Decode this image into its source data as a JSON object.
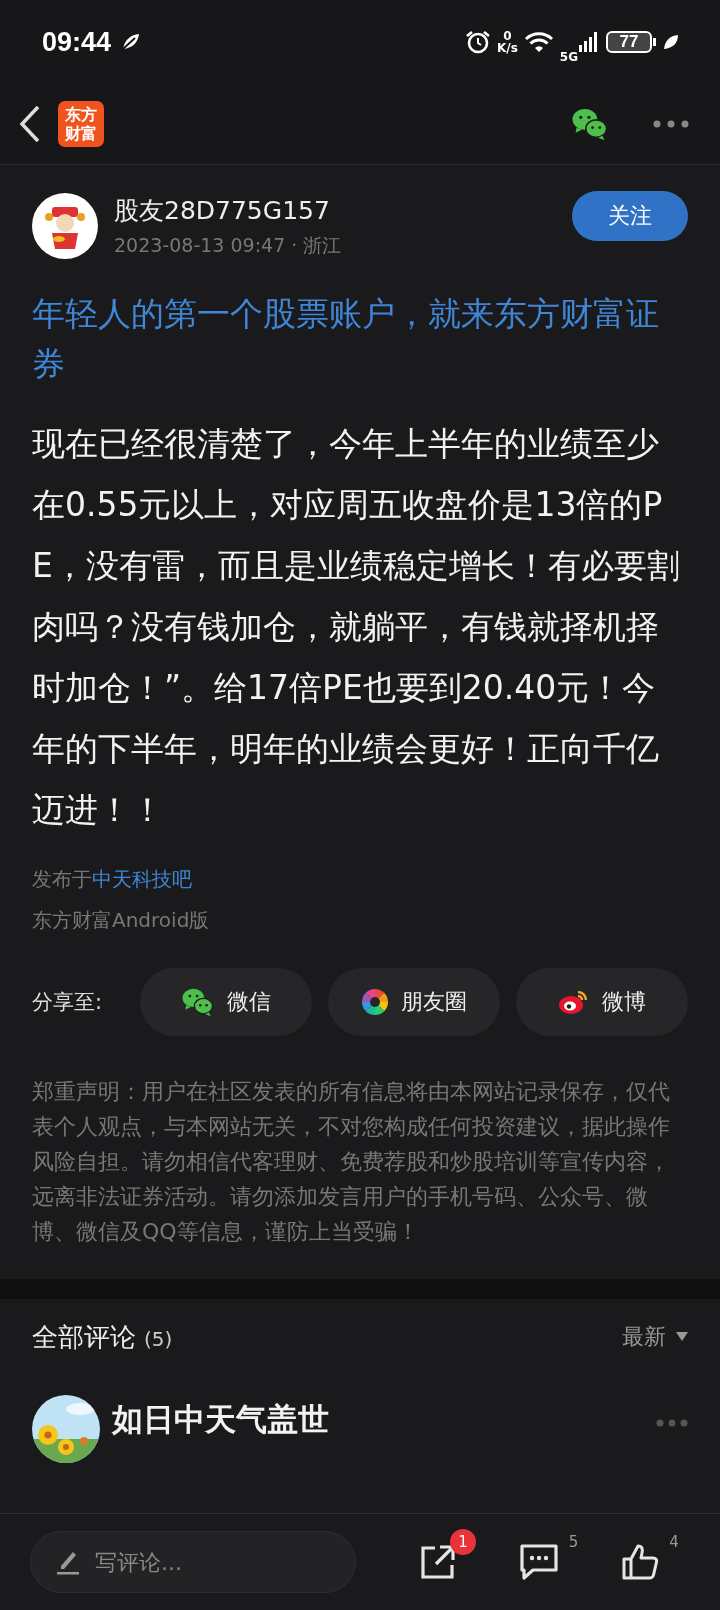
{
  "status_bar": {
    "time": "09:44",
    "net_speed_value": "0",
    "net_speed_unit": "K/s",
    "network": "5G",
    "battery": "77"
  },
  "header": {
    "logo": [
      "东方",
      "财富"
    ]
  },
  "post": {
    "author": "股友28D775G157",
    "meta": "2023-08-13 09:47 · 浙江",
    "follow_button": "关注",
    "title": "年轻人的第一个股票账户，就来东方财富证券",
    "body": "现在已经很清楚了，今年上半年的业绩至少在0.55元以上，对应周五收盘价是13倍的PE，没有雷，而且是业绩稳定增长！有必要割肉吗？没有钱加仓，就躺平，有钱就择机择时加仓！”。给17倍PE也要到20.40元！今年的下半年，明年的业绩会更好！正向千亿迈进！！",
    "published_in_label": "发布于",
    "forum": "中天科技吧",
    "source": "东方财富Android版"
  },
  "share": {
    "label": "分享至:",
    "buttons": [
      {
        "kind": "wechat",
        "label": "微信"
      },
      {
        "kind": "moments",
        "label": "朋友圈"
      },
      {
        "kind": "weibo",
        "label": "微博"
      }
    ]
  },
  "disclaimer": "郑重声明：用户在社区发表的所有信息将由本网站记录保存，仅代表个人观点，与本网站无关，不对您构成任何投资建议，据此操作风险自担。请勿相信代客理财、免费荐股和炒股培训等宣传内容，远离非法证券活动。请勿添加发言用户的手机号码、公众号、微博、微信及QQ等信息，谨防上当受骗！",
  "comments": {
    "title": "全部评论",
    "count": "(5)",
    "sort": "最新",
    "items": [
      {
        "author": "如日中天气盖世"
      }
    ]
  },
  "bottom_bar": {
    "placeholder": "写评论...",
    "share_badge": "1",
    "comment_count": "5",
    "like_count": "4"
  }
}
